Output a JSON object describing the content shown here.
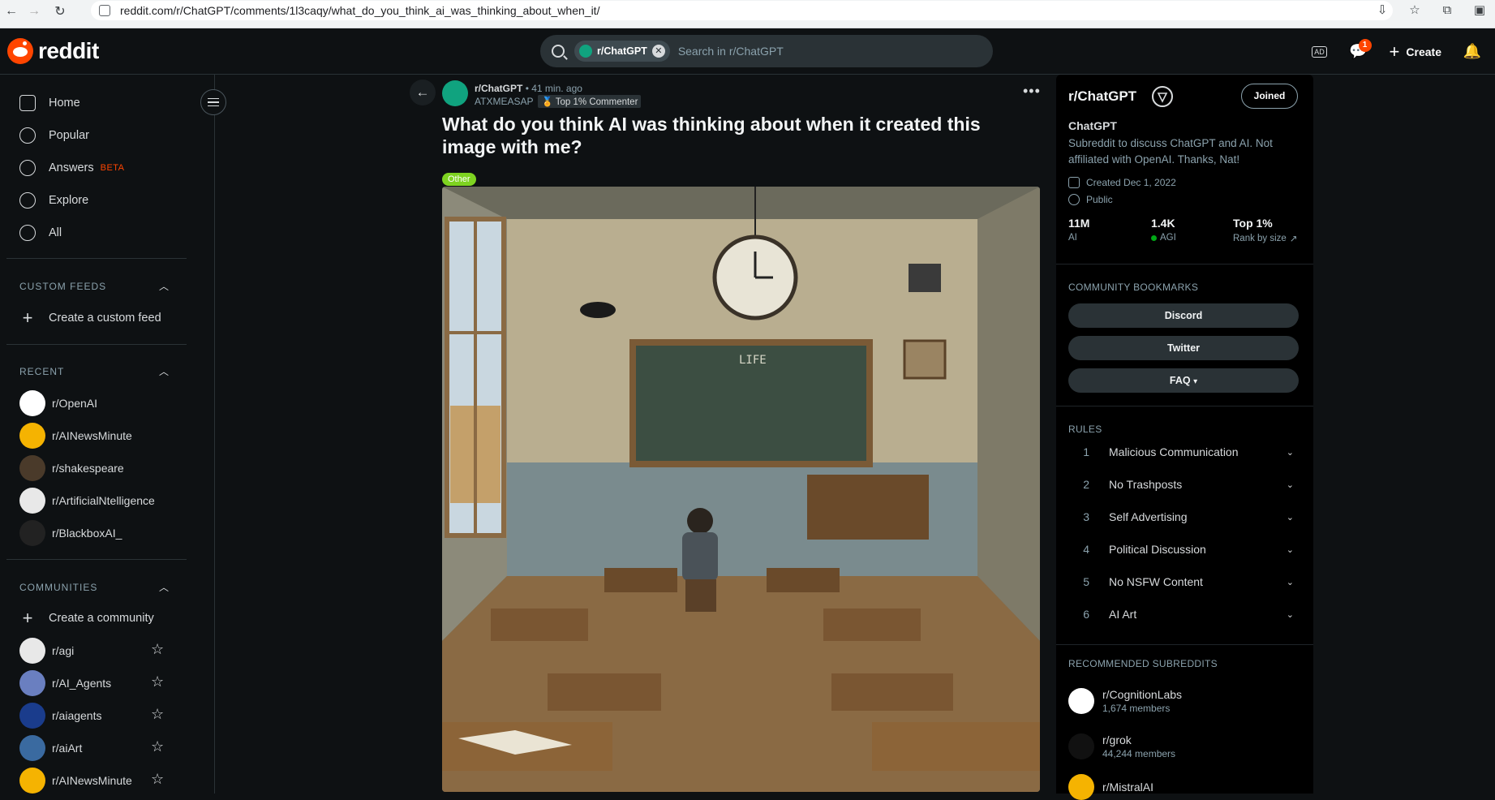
{
  "browser": {
    "url": "reddit.com/r/ChatGPT/comments/1l3caqy/what_do_you_think_ai_was_thinking_about_when_it/"
  },
  "header": {
    "logo_text": "reddit",
    "search_chip": "r/ChatGPT",
    "search_placeholder": "Search in r/ChatGPT",
    "notif_count": "1",
    "create_label": "Create"
  },
  "sidebar": {
    "nav": [
      {
        "label": "Home",
        "icon": "home-icon"
      },
      {
        "label": "Popular",
        "icon": "popular-icon"
      },
      {
        "label": "Answers",
        "icon": "answers-icon",
        "badge": "BETA"
      },
      {
        "label": "Explore",
        "icon": "explore-icon"
      },
      {
        "label": "All",
        "icon": "all-icon"
      }
    ],
    "custom_feeds_title": "CUSTOM FEEDS",
    "create_feed": "Create a custom feed",
    "recent_title": "RECENT",
    "recent": [
      {
        "name": "r/OpenAI",
        "color": "#ffffff"
      },
      {
        "name": "r/AINewsMinute",
        "color": "#f5b301"
      },
      {
        "name": "r/shakespeare",
        "color": "#4a3a2a"
      },
      {
        "name": "r/ArtificialNtelligence",
        "color": "#e8e8e8"
      },
      {
        "name": "r/BlackboxAI_",
        "color": "#222222"
      }
    ],
    "communities_title": "COMMUNITIES",
    "create_community": "Create a community",
    "communities": [
      {
        "name": "r/agi",
        "color": "#e8e8e8"
      },
      {
        "name": "r/AI_Agents",
        "color": "#6a7fc0"
      },
      {
        "name": "r/aiagents",
        "color": "#1a3c8c"
      },
      {
        "name": "r/aiArt",
        "color": "#3a6aa0"
      },
      {
        "name": "r/AINewsMinute",
        "color": "#f5b301"
      }
    ]
  },
  "post": {
    "subreddit": "r/ChatGPT",
    "time": "41 min. ago",
    "user": "ATXMEASAP",
    "user_flair": "Top 1% Commenter",
    "title": "What do you think AI was thinking about when it created this image with me?",
    "flair": "Other",
    "image_alt": "classroom-image"
  },
  "community": {
    "name": "r/ChatGPT",
    "joined_label": "Joined",
    "title": "ChatGPT",
    "description": "Subreddit to discuss ChatGPT and AI. Not affiliated with OpenAI. Thanks, Nat!",
    "created": "Created Dec 1, 2022",
    "visibility": "Public",
    "stats": [
      {
        "value": "11M",
        "label": "AI"
      },
      {
        "value": "1.4K",
        "label": "AGI"
      },
      {
        "value": "Top 1%",
        "label": "Rank by size"
      }
    ],
    "bookmarks_title": "COMMUNITY BOOKMARKS",
    "bookmarks": [
      "Discord",
      "Twitter",
      "FAQ"
    ],
    "rules_title": "RULES",
    "rules": [
      {
        "num": "1",
        "text": "Malicious Communication"
      },
      {
        "num": "2",
        "text": "No Trashposts"
      },
      {
        "num": "3",
        "text": "Self Advertising"
      },
      {
        "num": "4",
        "text": "Political Discussion"
      },
      {
        "num": "5",
        "text": "No NSFW Content"
      },
      {
        "num": "6",
        "text": "AI Art"
      }
    ],
    "recommended_title": "RECOMMENDED SUBREDDITS",
    "recommended": [
      {
        "name": "r/CognitionLabs",
        "members": "1,674 members",
        "color": "#ffffff"
      },
      {
        "name": "r/grok",
        "members": "44,244 members",
        "color": "#111111"
      },
      {
        "name": "r/MistralAI",
        "members": "",
        "color": "#f5b301"
      }
    ]
  }
}
